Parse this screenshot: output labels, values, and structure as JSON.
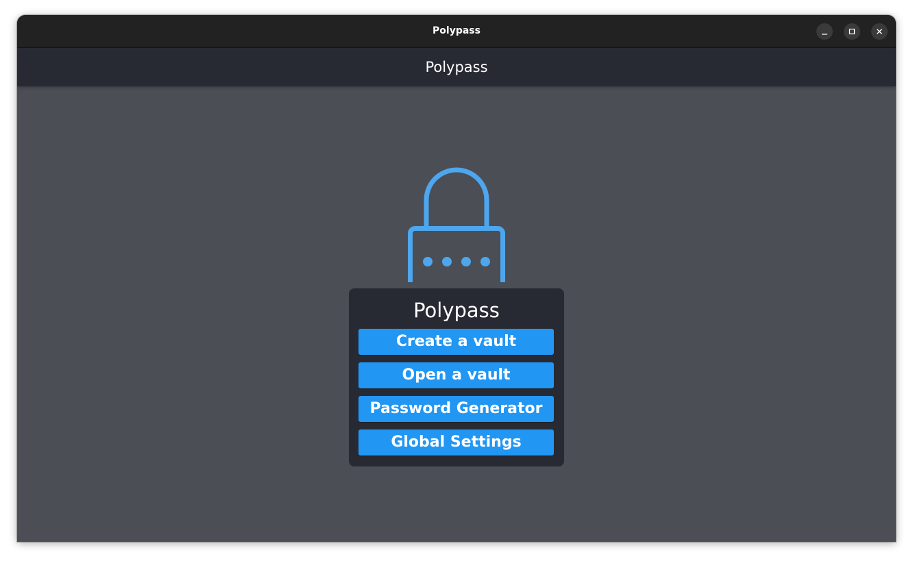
{
  "window": {
    "title": "Polypass",
    "controls": [
      "minimize-icon",
      "maximize-icon",
      "close-icon"
    ]
  },
  "appbar": {
    "title": "Polypass"
  },
  "hero": {
    "icon": "padlock-password-icon",
    "accent_color": "#4ea6ee"
  },
  "menu": {
    "title": "Polypass",
    "buttons": [
      {
        "label": "Create a vault"
      },
      {
        "label": "Open a vault"
      },
      {
        "label": "Password Generator"
      },
      {
        "label": "Global Settings"
      }
    ],
    "button_color": "#2196f3"
  }
}
